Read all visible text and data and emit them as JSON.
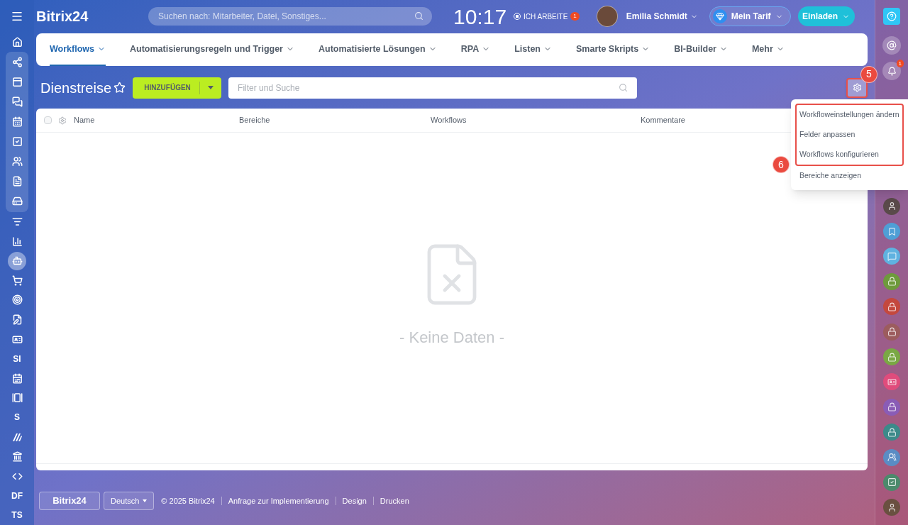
{
  "top_bar": {
    "logo": "Bitrix24",
    "search": {
      "placeholder": "Suchen nach: Mitarbeiter, Datei, Sonstiges..."
    },
    "clock": "10:17",
    "work_status": {
      "label": "ICH ARBEITE",
      "badge": "1"
    },
    "user": {
      "name": "Emilia Schmidt"
    },
    "plan_button": "Mein Tarif",
    "invite_button": "Einladen"
  },
  "nav_tabs": [
    {
      "label": "Workflows",
      "selected": true
    },
    {
      "label": "Automatisierungsregeln und Trigger",
      "selected": false
    },
    {
      "label": "Automatisierte Lösungen",
      "selected": false
    },
    {
      "label": "RPA",
      "selected": false
    },
    {
      "label": "Listen",
      "selected": false
    },
    {
      "label": "Smarte Skripts",
      "selected": false
    },
    {
      "label": "BI-Builder",
      "selected": false
    },
    {
      "label": "Mehr",
      "selected": false
    }
  ],
  "toolbar": {
    "title": "Dienstreise",
    "add_button": "HINZUFÜGEN",
    "filter": {
      "placeholder": "Filter und Suche"
    },
    "settings_step": "5"
  },
  "settings_menu": {
    "step": "6",
    "items": [
      {
        "label": "Workfloweinstellungen ändern",
        "highlighted": true
      },
      {
        "label": "Felder anpassen",
        "highlighted": true
      },
      {
        "label": "Workflows konfigurieren",
        "highlighted": true
      },
      {
        "label": "Bereiche anzeigen",
        "highlighted": false
      }
    ]
  },
  "table": {
    "select_all": {
      "checked": false
    },
    "columns": [
      "Name",
      "Bereiche",
      "Workflows",
      "Kommentare"
    ],
    "empty_text": "- Keine Daten -"
  },
  "footer": {
    "logo": "Bitrix24",
    "language": "Deutsch",
    "copyright": "© 2025 Bitrix24",
    "links": [
      "Anfrage zur Implementierung",
      "Design",
      "Drucken"
    ]
  },
  "left_sidebar": {
    "top": [
      {
        "selected": false
      }
    ],
    "group": [
      {
        "selected": false
      },
      {
        "selected": false
      },
      {
        "selected": false
      },
      {
        "selected": false
      },
      {
        "selected": false
      },
      {
        "selected": false
      },
      {
        "selected": false
      },
      {
        "selected": false
      }
    ],
    "items": [
      {
        "kind": "icon",
        "selected": false
      },
      {
        "kind": "icon",
        "selected": false
      },
      {
        "kind": "icon",
        "selected": true
      },
      {
        "kind": "icon",
        "selected": false
      },
      {
        "kind": "icon",
        "selected": false
      },
      {
        "kind": "icon",
        "selected": false
      },
      {
        "kind": "icon",
        "selected": false
      },
      {
        "kind": "text",
        "label": "SI",
        "selected": false
      },
      {
        "kind": "icon",
        "selected": false
      },
      {
        "kind": "icon",
        "selected": false
      },
      {
        "kind": "text",
        "label": "S",
        "selected": false
      },
      {
        "kind": "icon",
        "selected": false
      },
      {
        "kind": "icon",
        "selected": false
      },
      {
        "kind": "icon",
        "selected": false
      },
      {
        "kind": "text",
        "label": "DF",
        "selected": false
      },
      {
        "kind": "text",
        "label": "TS",
        "selected": false
      }
    ]
  },
  "right_sidebar": {
    "notifications_badge": "1",
    "items": [
      {
        "kind": "avatar",
        "color": "#5a4a4a"
      },
      {
        "kind": "bookmark",
        "color": "#4f9fd6"
      },
      {
        "kind": "chat",
        "color": "#5fb2e0"
      },
      {
        "kind": "lock",
        "color": "#6e9a3c"
      },
      {
        "kind": "lock",
        "color": "#c4483e"
      },
      {
        "kind": "lock",
        "color": "#9c5c5e"
      },
      {
        "kind": "lock",
        "color": "#7aa844"
      },
      {
        "kind": "card",
        "color": "#e04c7c"
      },
      {
        "kind": "lock",
        "color": "#8a5cb6"
      },
      {
        "kind": "lock",
        "color": "#3c8a8a"
      },
      {
        "kind": "users",
        "color": "#5a8cc4"
      },
      {
        "kind": "check",
        "color": "#4c8a6c"
      },
      {
        "kind": "avatar",
        "color": "#6a5040"
      }
    ]
  }
}
